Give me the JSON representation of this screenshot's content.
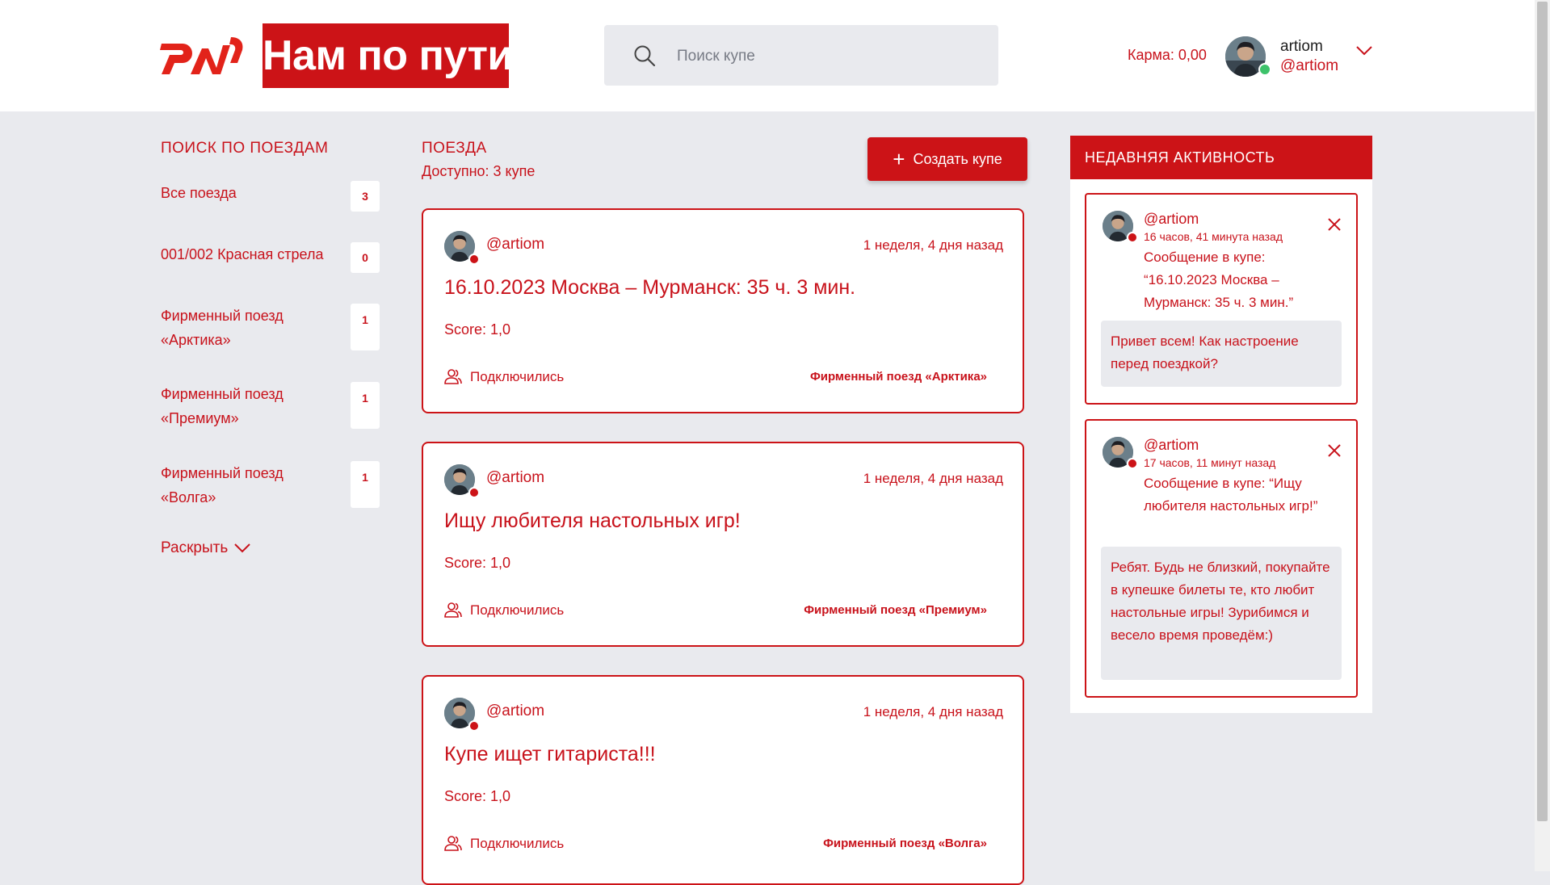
{
  "header": {
    "brand_text": "Нам по пути",
    "logo_text": "РЖД",
    "search_placeholder": "Поиск купе",
    "karma": "Карма: 0,00",
    "user_name": "artiom",
    "user_handle": "@artiom"
  },
  "filter": {
    "title": "ПОИСК ПО ПОЕЗДАМ",
    "items": [
      {
        "label": "Все поезда",
        "count": "3"
      },
      {
        "label": "001/002 Красная стрела",
        "count": "0"
      },
      {
        "label": "Фирменный поезд «Арктика»",
        "count": "1"
      },
      {
        "label": "Фирменный поезд «Премиум»",
        "count": "1"
      },
      {
        "label": "Фирменный поезд «Волга»",
        "count": "1"
      }
    ],
    "expand_label": "Раскрыть"
  },
  "trains": {
    "title": "ПОЕЗДА",
    "available": "Доступно: 3 купе",
    "create_label": "Создать купе",
    "posts": [
      {
        "author": "@artiom",
        "time": "1 неделя, 4 дня назад",
        "title": "16.10.2023 Москва – Мурманск: 35 ч. 3 мин.",
        "score": "Score: 1,0",
        "joined": "Подключились",
        "train": "Фирменный поезд «Арктика»"
      },
      {
        "author": "@artiom",
        "time": "1 неделя, 4 дня назад",
        "title": "Ищу любителя настольных игр!",
        "score": "Score: 1,0",
        "joined": "Подключились",
        "train": "Фирменный поезд «Премиум»"
      },
      {
        "author": "@artiom",
        "time": "1 неделя, 4 дня назад",
        "title": "Купе ищет гитариста!!!",
        "score": "Score: 1,0",
        "joined": "Подключились",
        "train": "Фирменный поезд «Волга»"
      }
    ]
  },
  "activity": {
    "title": "НЕДАВНЯЯ АКТИВНОСТЬ",
    "items": [
      {
        "author": "@artiom",
        "time": "16 часов, 41 минута назад",
        "message": "Сообщение в купе: “16.10.2023 Москва – Мурманск: 35 ч. 3 мин.”",
        "quote": "Привет всем! Как настроение перед поездкой?"
      },
      {
        "author": "@artiom",
        "time": "17 часов, 11 минут назад",
        "message": "Сообщение в купе: “Ищу любителя настольных игр!”",
        "quote": "Ребят. Будь не близкий, покупайте в купешке билеты те, кто любит настольные игры! Зурибимся и весело время проведём:)"
      }
    ]
  },
  "colors": {
    "accent": "#cc1317",
    "background": "#e9eaee",
    "online": "#3dc26a"
  }
}
